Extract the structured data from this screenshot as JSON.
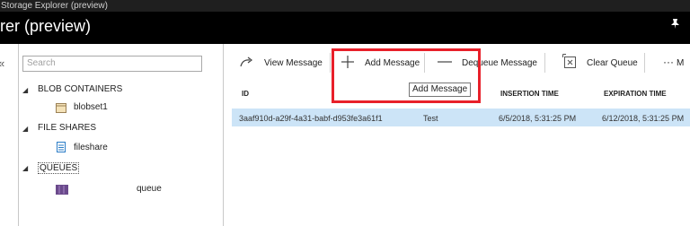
{
  "window": {
    "title_bar": "Storage Explorer (preview)",
    "header_title": "rer (preview)"
  },
  "explorer": {
    "search_placeholder": "Search",
    "blob_containers": "BLOB CONTAINERS",
    "blob_item": "blobset1",
    "file_shares": "FILE SHARES",
    "file_item": "fileshare",
    "queues": "QUEUES",
    "queue_item": "queue"
  },
  "toolbar": {
    "view_message": "View Message",
    "add_message": "Add Message",
    "dequeue_message": "Dequeue Message",
    "clear_queue": "Clear Queue",
    "more": "M",
    "add_tooltip": "Add Message"
  },
  "table": {
    "columns": [
      "ID",
      "INSERTION TIME",
      "EXPIRATION TIME"
    ],
    "rows": [
      {
        "id": "3aaf910d-a29f-4a31-babf-d953fe3a61f1",
        "text": "Test",
        "insertion": "6/5/2018, 5:31:25 PM",
        "expiration": "6/12/2018, 5:31:25 PM"
      }
    ]
  },
  "colors": {
    "highlight": "#e8202a",
    "selected_row": "#cce4f7",
    "header_bg": "#000000"
  }
}
